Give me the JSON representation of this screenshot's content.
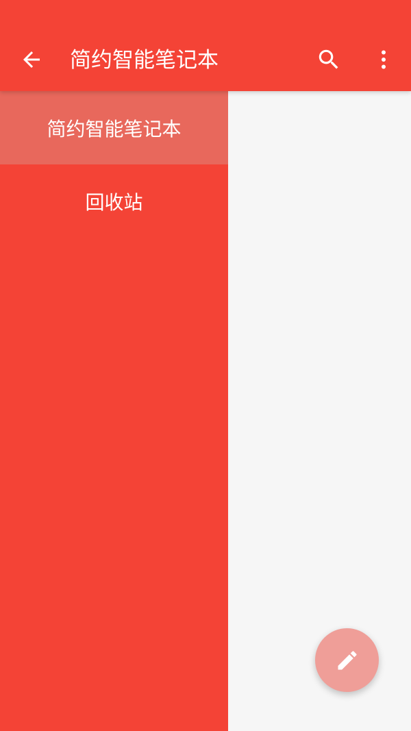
{
  "appbar": {
    "title": "简约智能笔记本",
    "back_icon": "arrow-back-icon",
    "search_icon": "search-icon",
    "more_icon": "more-vert-icon",
    "color": "#f44336"
  },
  "drawer": {
    "items": [
      {
        "label": "简约智能笔记本",
        "selected": true
      },
      {
        "label": "回收站",
        "selected": false
      }
    ],
    "background": "#f44336",
    "selected_background": "#e8685c"
  },
  "fab": {
    "icon": "pencil-icon",
    "color": "#ef9e98"
  }
}
